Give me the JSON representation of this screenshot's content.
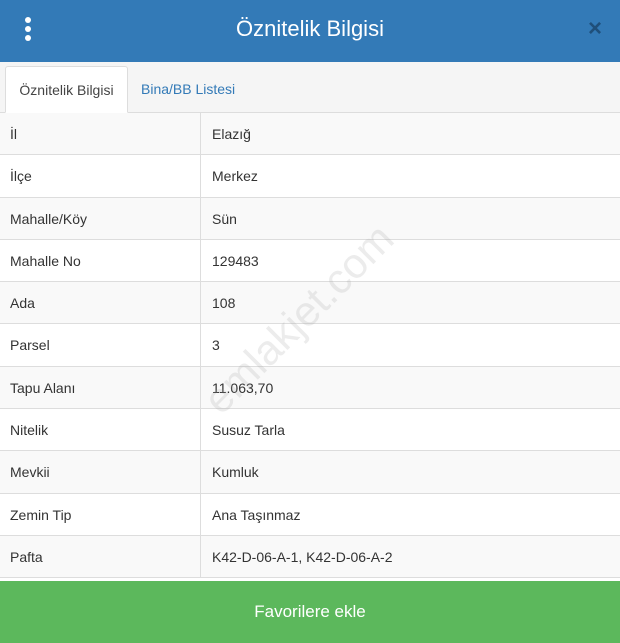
{
  "header": {
    "title": "Öznitelik Bilgisi",
    "close_label": "×",
    "menu_icon": "vertical-dots-icon",
    "color": "#337ab7"
  },
  "tabs": [
    {
      "label": "Öznitelik Bilgisi",
      "active": true
    },
    {
      "label": "Bina/BB Listesi",
      "active": false
    }
  ],
  "attributes": [
    {
      "label": "İl",
      "value": "Elazığ"
    },
    {
      "label": "İlçe",
      "value": "Merkez"
    },
    {
      "label": "Mahalle/Köy",
      "value": "Sün"
    },
    {
      "label": "Mahalle No",
      "value": "129483"
    },
    {
      "label": "Ada",
      "value": "108"
    },
    {
      "label": "Parsel",
      "value": "3"
    },
    {
      "label": "Tapu Alanı",
      "value": "11.063,70"
    },
    {
      "label": "Nitelik",
      "value": "Susuz Tarla"
    },
    {
      "label": "Mevkii",
      "value": "Kumluk"
    },
    {
      "label": "Zemin Tip",
      "value": "Ana Taşınmaz"
    },
    {
      "label": "Pafta",
      "value": "K42-D-06-A-1, K42-D-06-A-2"
    }
  ],
  "watermark": "emlakjet.com",
  "footer": {
    "favorite_label": "Favorilere ekle",
    "color": "#5cb85c"
  }
}
